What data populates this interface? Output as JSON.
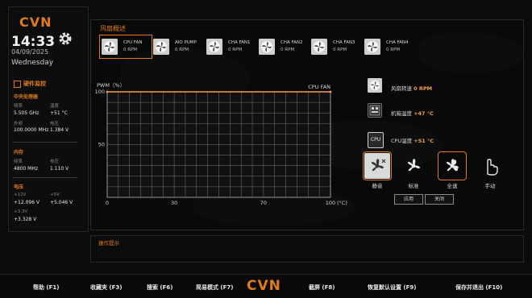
{
  "brand": "CVN",
  "clock": {
    "time": "14:33",
    "date": "04/09/2025",
    "weekday": "Wednesday"
  },
  "hardware_monitor": {
    "title": "硬件监控",
    "cpu": {
      "title": "中央处理器",
      "freq_label": "频率",
      "temp_label": "温度",
      "freq": "5.505 GHz",
      "temp": "+51 °C",
      "ext_label": "外频",
      "volt_label": "电压",
      "ext": "100.0000 MHz",
      "volt": "1.384 V"
    },
    "memory": {
      "title": "内存",
      "freq_label": "频率",
      "volt_label": "电压",
      "freq": "4800 MHz",
      "volt": "1.110 V"
    },
    "voltage": {
      "title": "电压",
      "v12_label": "+12V",
      "v5_label": "+5V",
      "v12": "+12.096 V",
      "v5": "+5.046 V",
      "v33_label": "+3.3V",
      "v33": "+3.328 V"
    }
  },
  "fan_overview": {
    "title": "风扇概述",
    "fans": [
      {
        "name": "CPU FAN",
        "rpm": "0 RPM"
      },
      {
        "name": "AIO PUMP",
        "rpm": "0 RPM"
      },
      {
        "name": "CHA FAN1",
        "rpm": "0 RPM"
      },
      {
        "name": "CHA FAN2",
        "rpm": "0 RPM"
      },
      {
        "name": "CHA FAN3",
        "rpm": "0 RPM"
      },
      {
        "name": "CHA FAN4",
        "rpm": "0 RPM"
      }
    ]
  },
  "chart_data": {
    "type": "line",
    "ylabel": "PWM（%）",
    "xlabel": "(°C)",
    "series_label": "CPU FAN",
    "xlim": [
      0,
      100
    ],
    "ylim": [
      0,
      100
    ],
    "x_ticks": [
      "0",
      "30",
      "70",
      "100"
    ],
    "y_ticks": [
      "100",
      "50"
    ],
    "grid": true,
    "series": [
      {
        "x": [
          0,
          100
        ],
        "y": [
          100,
          100
        ]
      }
    ]
  },
  "status": {
    "fan_speed_label": "风扇转速",
    "fan_speed": "0 RPM",
    "chassis_temp_label": "机箱温度",
    "chassis_temp": "+47 °C",
    "cpu_chip": "CPU",
    "cpu_temp_label": "CPU温度",
    "cpu_temp": "+51 °C"
  },
  "modes": [
    {
      "label": "静音"
    },
    {
      "label": "标准"
    },
    {
      "label": "全速"
    },
    {
      "label": "手动"
    }
  ],
  "actions": {
    "apply": "应用",
    "close": "关闭"
  },
  "tips": {
    "label": "操作提示"
  },
  "bottom_bar": {
    "help": "帮助 (F1)",
    "favorites": "收藏夹 (F3)",
    "search": "搜索 (F6)",
    "easy_mode": "简易模式 (F7)",
    "screenshot": "截屏 (F8)",
    "defaults": "恢复默认设置 (F9)",
    "save_exit": "保存并退出 (F10)"
  },
  "colors": {
    "accent": "#e07b1e",
    "background": "#0b0b0b",
    "curve": "#f0a050"
  }
}
